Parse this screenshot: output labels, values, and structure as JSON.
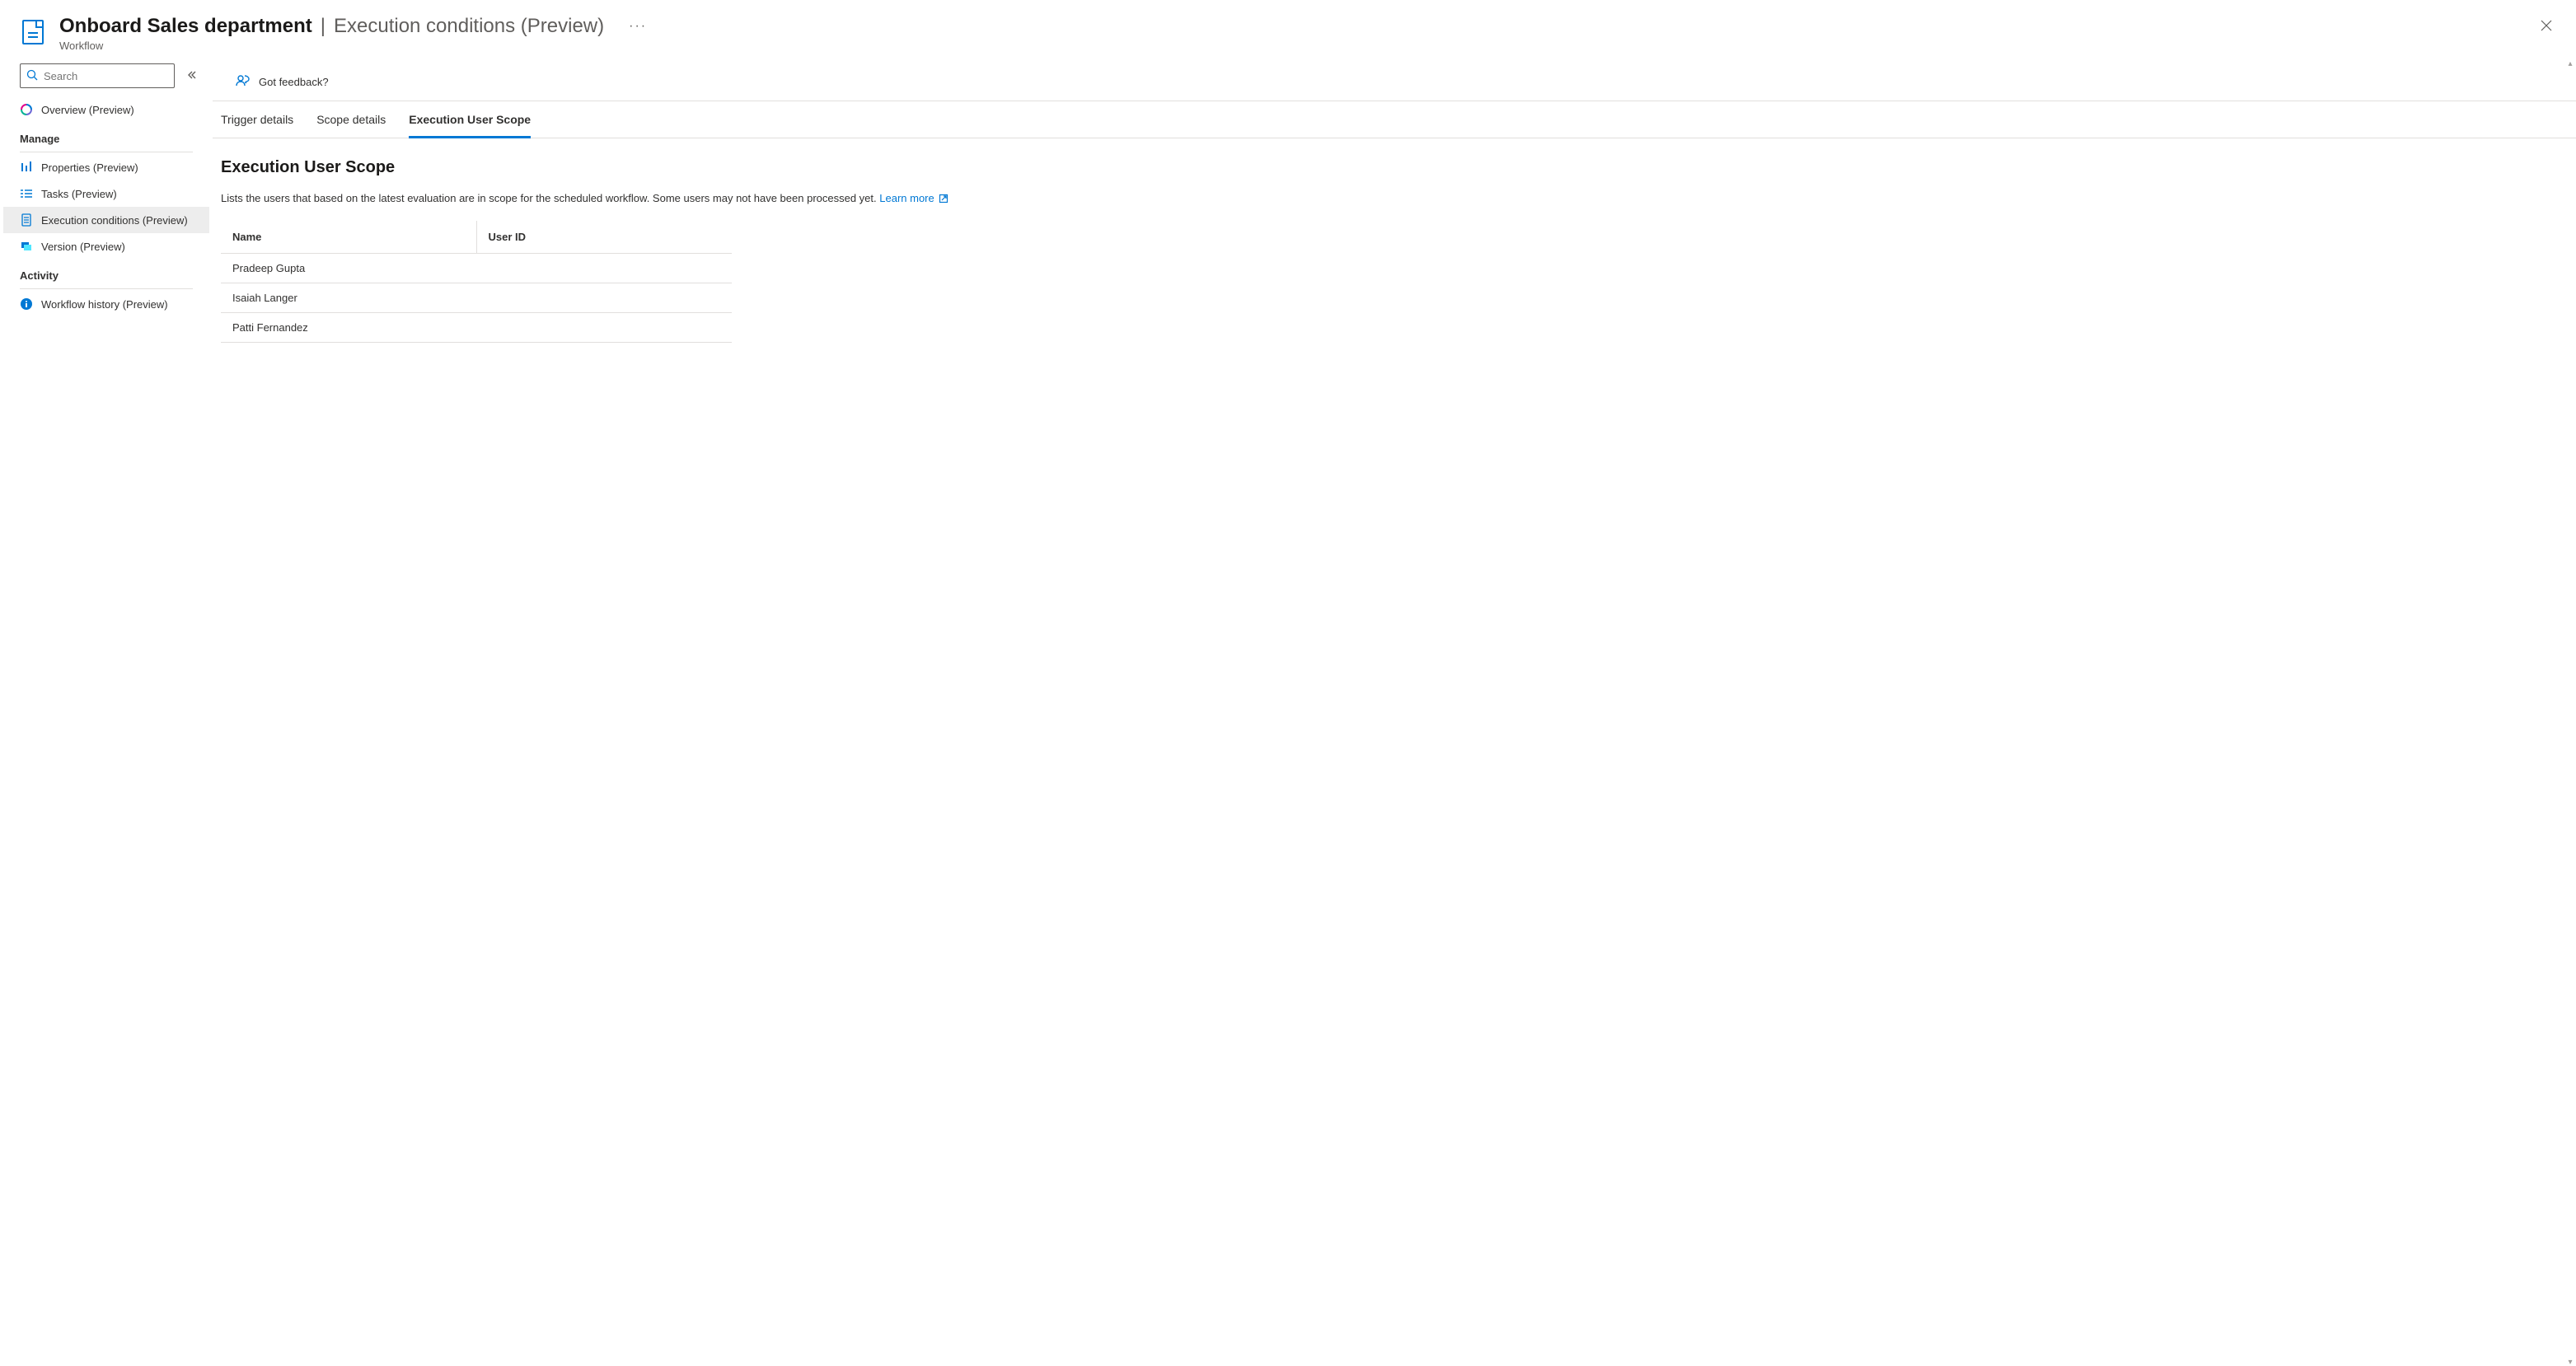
{
  "header": {
    "title": "Onboard Sales department",
    "separator": "|",
    "subtitle": "Execution conditions (Preview)",
    "breadcrumb": "Workflow",
    "more_label": "···"
  },
  "search": {
    "placeholder": "Search"
  },
  "sidebar": {
    "overview_label": "Overview (Preview)",
    "section_manage": "Manage",
    "items_manage": [
      {
        "label": "Properties (Preview)"
      },
      {
        "label": "Tasks (Preview)"
      },
      {
        "label": "Execution conditions (Preview)"
      },
      {
        "label": "Version (Preview)"
      }
    ],
    "section_activity": "Activity",
    "items_activity": [
      {
        "label": "Workflow history (Preview)"
      }
    ]
  },
  "feedback": {
    "label": "Got feedback?"
  },
  "tabs": [
    {
      "label": "Trigger details"
    },
    {
      "label": "Scope details"
    },
    {
      "label": "Execution User Scope"
    }
  ],
  "content": {
    "title": "Execution User Scope",
    "description": "Lists the users that based on the latest evaluation are in scope for the scheduled workflow. Some users may not have been processed yet.",
    "learn_more": "Learn more"
  },
  "table": {
    "columns": [
      "Name",
      "User ID"
    ],
    "rows": [
      {
        "name": "Pradeep Gupta",
        "userid": ""
      },
      {
        "name": "Isaiah Langer",
        "userid": ""
      },
      {
        "name": "Patti Fernandez",
        "userid": ""
      }
    ]
  }
}
